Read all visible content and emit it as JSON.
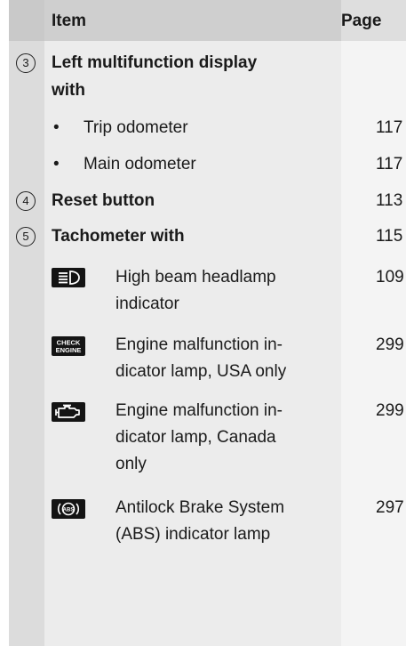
{
  "header": {
    "item": "Item",
    "page": "Page"
  },
  "rows": [
    {
      "num": "3",
      "title_line1": "Left multifunction display",
      "title_line2": "with",
      "page": ""
    },
    {
      "bullet": "•",
      "label": "Trip odometer",
      "page": "117"
    },
    {
      "bullet": "•",
      "label": "Main odometer",
      "page": "117"
    },
    {
      "num": "4",
      "title": "Reset button",
      "page": "113"
    },
    {
      "num": "5",
      "title": "Tachometer with",
      "page": "115"
    }
  ],
  "indicators": [
    {
      "icon": "high-beam-icon",
      "line1": "High beam headlamp",
      "line2": "indicator",
      "page": "109"
    },
    {
      "icon": "check-engine-icon",
      "icon_text_1": "CHECK",
      "icon_text_2": "ENGINE",
      "line1": "Engine malfunction in-",
      "line2": "dicator lamp, USA only",
      "page": "299"
    },
    {
      "icon": "engine-icon",
      "line1": "Engine malfunction in-",
      "line2": "dicator lamp, Canada",
      "line3": "only",
      "page": "299"
    },
    {
      "icon": "abs-icon",
      "icon_text": "ABS",
      "line1": "Antilock Brake System",
      "line2": "(ABS) indicator lamp",
      "page": "297"
    }
  ]
}
